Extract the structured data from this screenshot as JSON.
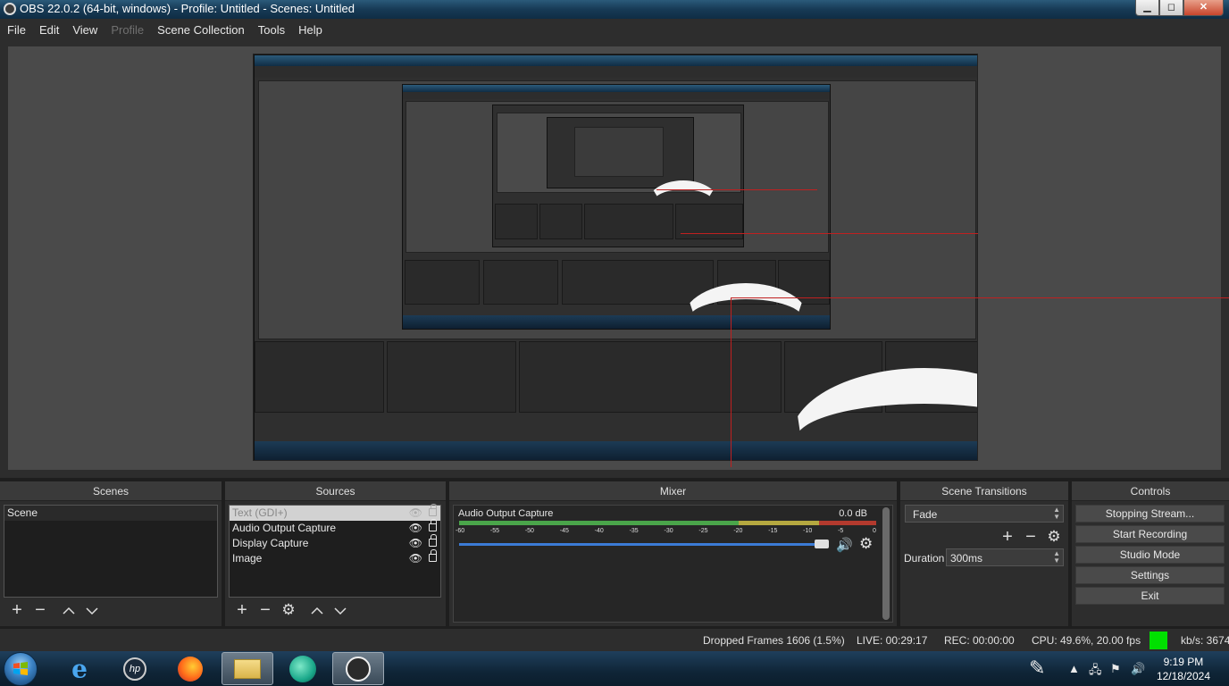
{
  "window": {
    "title": "OBS 22.0.2 (64-bit, windows) - Profile: Untitled - Scenes: Untitled",
    "controls": [
      "minimize",
      "maximize",
      "close"
    ]
  },
  "menu": {
    "items": [
      {
        "label": "File",
        "enabled": true
      },
      {
        "label": "Edit",
        "enabled": true
      },
      {
        "label": "View",
        "enabled": true
      },
      {
        "label": "Profile",
        "enabled": false
      },
      {
        "label": "Scene Collection",
        "enabled": true
      },
      {
        "label": "Tools",
        "enabled": true
      },
      {
        "label": "Help",
        "enabled": true
      }
    ]
  },
  "scenes": {
    "header": "Scenes",
    "items": [
      "Scene"
    ]
  },
  "sources": {
    "header": "Sources",
    "items": [
      {
        "label": "Text (GDI+)",
        "selected": true
      },
      {
        "label": "Audio Output Capture",
        "selected": false
      },
      {
        "label": "Display Capture",
        "selected": false
      },
      {
        "label": "Image",
        "selected": false
      }
    ]
  },
  "mixer": {
    "header": "Mixer",
    "track_name": "Audio Output Capture",
    "level": "0.0 dB",
    "ticks": [
      "-60",
      "-55",
      "-50",
      "-45",
      "-40",
      "-35",
      "-30",
      "-25",
      "-20",
      "-15",
      "-10",
      "-5",
      "0"
    ]
  },
  "transitions": {
    "header": "Scene Transitions",
    "selected": "Fade",
    "duration_label": "Duration",
    "duration_value": "300ms"
  },
  "controls": {
    "header": "Controls",
    "buttons": [
      "Stopping Stream...",
      "Start Recording",
      "Studio Mode",
      "Settings",
      "Exit"
    ]
  },
  "status": {
    "dropped": "Dropped Frames 1606 (1.5%)",
    "live": "LIVE: 00:29:17",
    "rec": "REC: 00:00:00",
    "cpu": "CPU: 49.6%, 20.00 fps",
    "kbps": "kb/s: 3674",
    "indicator_color": "#00e000"
  },
  "taskbar": {
    "apps": [
      "start-orb",
      "internet-explorer-icon",
      "hp-icon",
      "firefox-icon",
      "file-explorer-icon",
      "green-app-icon",
      "obs-icon"
    ],
    "time": "9:19 PM",
    "date": "12/18/2024"
  },
  "colors": {
    "titlebar": "#173a55",
    "panel": "#2d2d2d",
    "dock_header": "#3a3a3a",
    "button": "#4a4a4a",
    "meter_green": "#4aa54a",
    "meter_yellow": "#b5a840",
    "meter_red": "#b33a2e",
    "slider_blue": "#3b7bd6"
  }
}
